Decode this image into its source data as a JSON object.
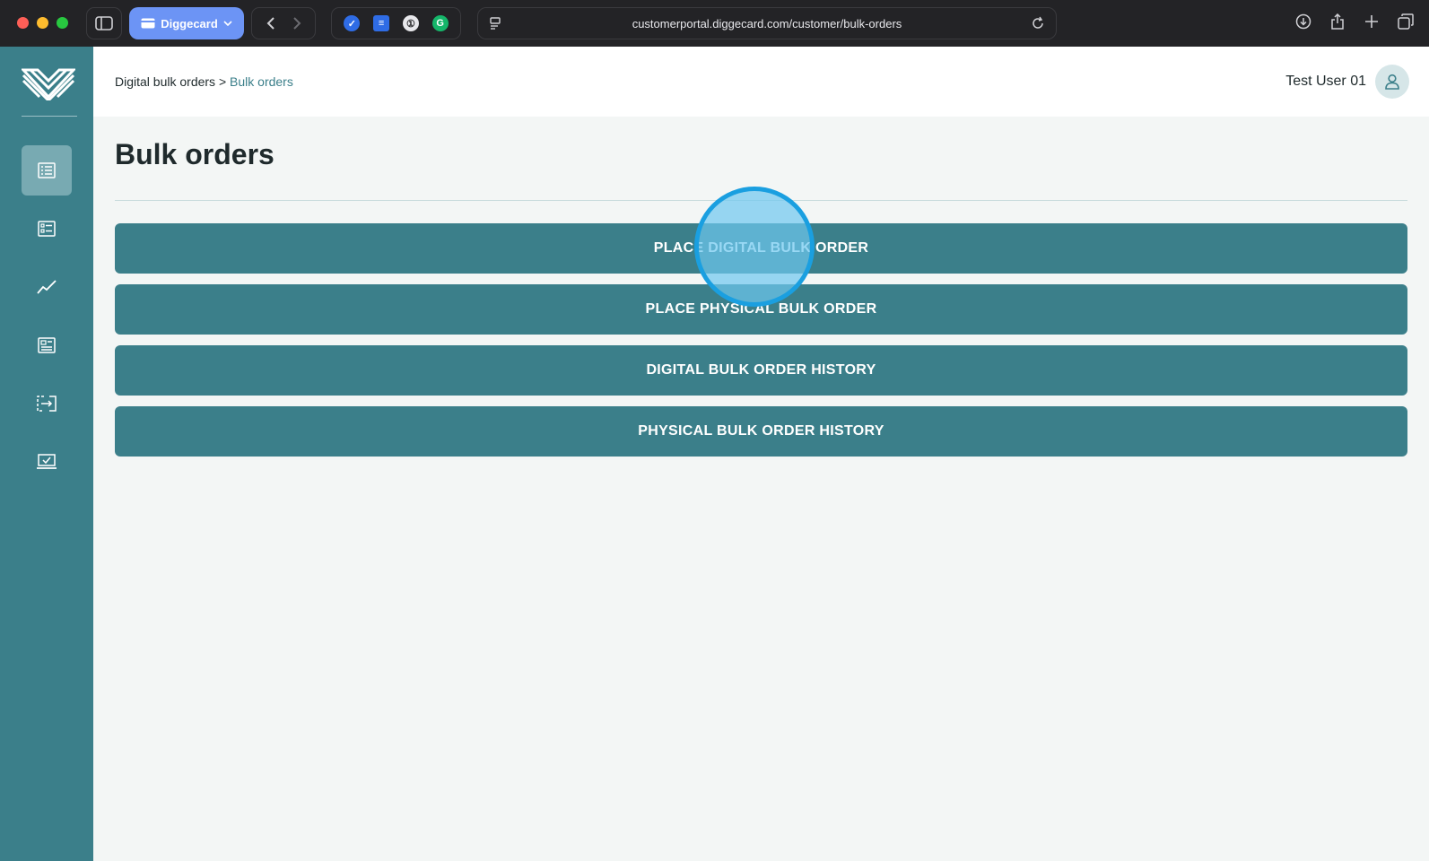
{
  "browser": {
    "tab_group_label": "Diggecard",
    "url": "customerportal.diggecard.com/customer/bulk-orders"
  },
  "breadcrumb": {
    "parent": "Digital bulk orders",
    "separator": ">",
    "current": "Bulk orders"
  },
  "user": {
    "name": "Test User 01"
  },
  "page": {
    "title": "Bulk orders"
  },
  "actions": [
    {
      "label": "PLACE DIGITAL BULK ORDER"
    },
    {
      "label": "PLACE PHYSICAL BULK ORDER"
    },
    {
      "label": "DIGITAL BULK ORDER HISTORY"
    },
    {
      "label": "PHYSICAL BULK ORDER HISTORY"
    }
  ],
  "sidebar": {
    "items": [
      {
        "icon": "list-orders-icon",
        "active": true
      },
      {
        "icon": "checklist-icon",
        "active": false
      },
      {
        "icon": "trend-chart-icon",
        "active": false
      },
      {
        "icon": "report-icon",
        "active": false
      },
      {
        "icon": "transfer-icon",
        "active": false
      },
      {
        "icon": "laptop-check-icon",
        "active": false
      }
    ]
  },
  "colors": {
    "brand": "#3b7f8a",
    "sidebar_active": "#78aab2",
    "click_indicator": "#1a9fe0"
  }
}
